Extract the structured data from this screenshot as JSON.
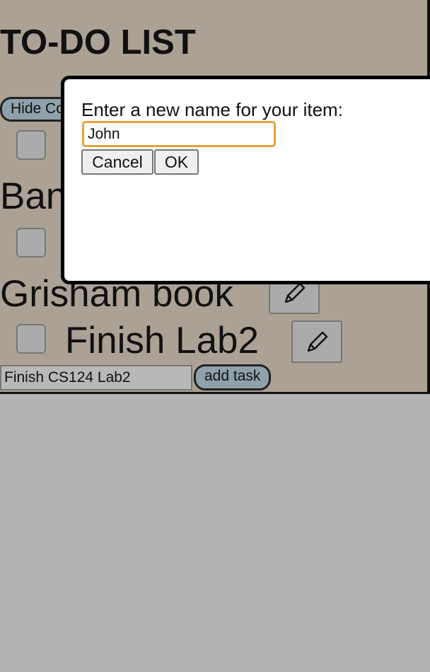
{
  "page": {
    "title": "TO-DO LIST"
  },
  "controls": {
    "hide_completed_label": "Hide Completed",
    "add_task_label": "add task",
    "new_task_value": "Finish CS124 Lab2"
  },
  "tasks": [
    {
      "label": ""
    },
    {
      "label": "Bananas"
    },
    {
      "label": "Grisham book"
    },
    {
      "label": "Finish Lab2"
    }
  ],
  "dialog": {
    "message": "Enter a new name for your item:",
    "input_value": "John",
    "cancel_label": "Cancel",
    "ok_label": "OK"
  },
  "icons": {
    "edit": "pencil-icon"
  },
  "colors": {
    "app_bg": "#aba295",
    "page_bg": "#b3b3b3",
    "button_bg": "#8fa1ab",
    "focus_ring": "#e6a13a"
  }
}
